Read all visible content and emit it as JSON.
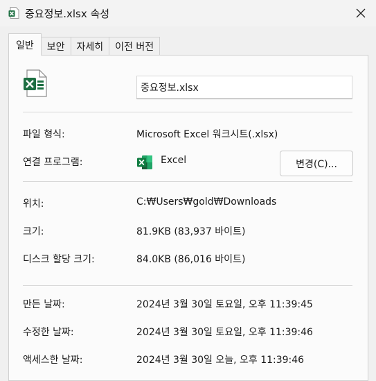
{
  "window": {
    "title": "중요정보.xlsx 속성",
    "close_glyph": "✕"
  },
  "tabs": [
    {
      "label": "일반",
      "active": true
    },
    {
      "label": "보안"
    },
    {
      "label": "자세히"
    },
    {
      "label": "이전 버전"
    }
  ],
  "general": {
    "filename_value": "중요정보.xlsx",
    "filetype": {
      "label": "파일 형식:",
      "value": "Microsoft Excel 워크시트(.xlsx)"
    },
    "open_with": {
      "label": "연결 프로그램:",
      "app_name": "Excel",
      "change_button": "변경(C)..."
    },
    "location": {
      "label": "위치:",
      "value": "C:₩Users₩gold₩Downloads"
    },
    "size": {
      "label": "크기:",
      "value": "81.9KB (83,937 바이트)"
    },
    "size_on_disk": {
      "label": "디스크 할당 크기:",
      "value": "84.0KB (86,016 바이트)"
    },
    "created": {
      "label": "만든 날짜:",
      "value": "2024년 3월 30일 토요일, 오후 11:39:45"
    },
    "modified": {
      "label": "수정한 날짜:",
      "value": "2024년 3월 30일 토요일, 오후 11:39:46"
    },
    "accessed": {
      "label": "액세스한 날짜:",
      "value": "2024년 3월 30일 오늘, 오후 11:39:46"
    }
  },
  "colors": {
    "excel_green": "#1d6f42",
    "excel_dark": "#185c37"
  },
  "icons": [
    "excel-file-icon",
    "excel-app-icon",
    "close-icon"
  ]
}
